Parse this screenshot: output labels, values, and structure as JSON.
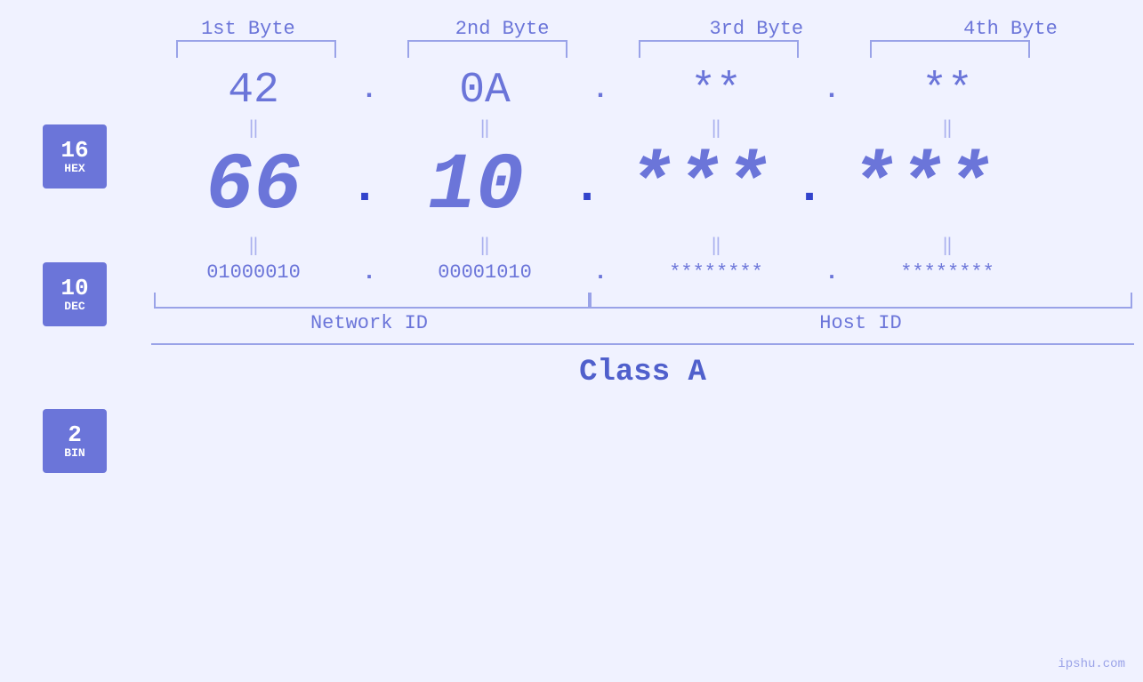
{
  "bytes": {
    "labels": [
      "1st Byte",
      "2nd Byte",
      "3rd Byte",
      "4th Byte"
    ],
    "hex": [
      "42",
      "0A",
      "**",
      "**"
    ],
    "dec": [
      "66",
      "10",
      "***",
      "***"
    ],
    "bin": [
      "01000010",
      "00001010",
      "********",
      "********"
    ]
  },
  "bases": [
    {
      "number": "16",
      "name": "HEX"
    },
    {
      "number": "10",
      "name": "DEC"
    },
    {
      "number": "2",
      "name": "BIN"
    }
  ],
  "labels": {
    "networkId": "Network ID",
    "hostId": "Host ID",
    "classA": "Class A",
    "watermark": "ipshu.com"
  },
  "colors": {
    "accent": "#6b75d9",
    "badge": "#6b75d9",
    "light": "#9aa3e8",
    "bg": "#f0f2ff"
  }
}
